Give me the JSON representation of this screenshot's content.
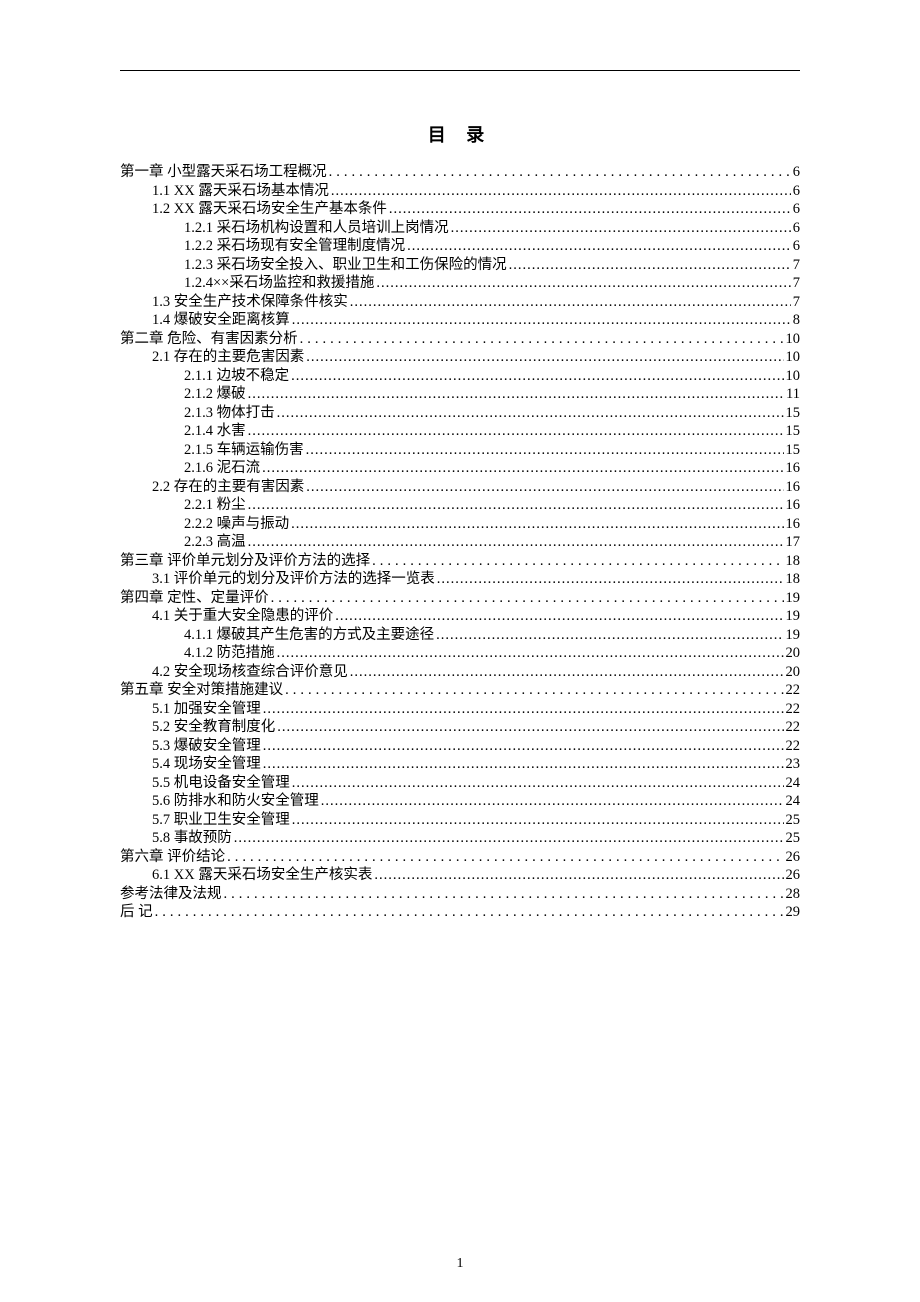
{
  "title": "目 录",
  "page_number": "1",
  "toc": [
    {
      "level": 0,
      "label": "第一章   小型露天采石场工程概况",
      "page": "6",
      "wide": true
    },
    {
      "level": 1,
      "label": "1.1 XX 露天采石场基本情况",
      "page": "6",
      "wide": false
    },
    {
      "level": 1,
      "label": "1.2 XX 露天采石场安全生产基本条件",
      "page": "6",
      "wide": false
    },
    {
      "level": 2,
      "label": "1.2.1 采石场机构设置和人员培训上岗情况",
      "page": "6",
      "wide": false
    },
    {
      "level": 2,
      "label": "1.2.2 采石场现有安全管理制度情况",
      "page": "6",
      "wide": false
    },
    {
      "level": 2,
      "label": "1.2.3 采石场安全投入、职业卫生和工伤保险的情况",
      "page": "7",
      "wide": false
    },
    {
      "level": 2,
      "label": "1.2.4××采石场监控和救援措施",
      "page": "7",
      "wide": false
    },
    {
      "level": 1,
      "label": "1.3 安全生产技术保障条件核实",
      "page": "7",
      "wide": false
    },
    {
      "level": 1,
      "label": "1.4 爆破安全距离核算",
      "page": "8",
      "wide": false
    },
    {
      "level": 0,
      "label": "第二章   危险、有害因素分析",
      "page": "10",
      "wide": true
    },
    {
      "level": 1,
      "label": "2.1 存在的主要危害因素",
      "page": "10",
      "wide": false
    },
    {
      "level": 2,
      "label": "2.1.1 边坡不稳定",
      "page": "10",
      "wide": false
    },
    {
      "level": 2,
      "label": "2.1.2 爆破",
      "page": "11",
      "wide": false
    },
    {
      "level": 2,
      "label": "2.1.3 物体打击",
      "page": "15",
      "wide": false
    },
    {
      "level": 2,
      "label": "2.1.4 水害",
      "page": "15",
      "wide": false
    },
    {
      "level": 2,
      "label": "2.1.5 车辆运输伤害",
      "page": "15",
      "wide": false
    },
    {
      "level": 2,
      "label": "2.1.6 泥石流",
      "page": "16",
      "wide": false
    },
    {
      "level": 1,
      "label": "2.2  存在的主要有害因素",
      "page": "16",
      "wide": false
    },
    {
      "level": 2,
      "label": "2.2.1 粉尘",
      "page": "16",
      "wide": false
    },
    {
      "level": 2,
      "label": "2.2.2 噪声与振动",
      "page": "16",
      "wide": false
    },
    {
      "level": 2,
      "label": "2.2.3 高温",
      "page": "17",
      "wide": false
    },
    {
      "level": 0,
      "label": "第三章   评价单元划分及评价方法的选择",
      "page": "18",
      "wide": true
    },
    {
      "level": 1,
      "label": "3.1 评价单元的划分及评价方法的选择一览表",
      "page": "18",
      "wide": false
    },
    {
      "level": 0,
      "label": "第四章   定性、定量评价",
      "page": "19",
      "wide": true
    },
    {
      "level": 1,
      "label": "4.1 关于重大安全隐患的评价",
      "page": "19",
      "wide": false
    },
    {
      "level": 2,
      "label": "4.1.1 爆破其产生危害的方式及主要途径",
      "page": "19",
      "wide": false
    },
    {
      "level": 2,
      "label": "4.1.2 防范措施",
      "page": "20",
      "wide": false
    },
    {
      "level": 1,
      "label": "4.2 安全现场核查综合评价意见",
      "page": "20",
      "wide": false
    },
    {
      "level": 0,
      "label": "第五章   安全对策措施建议",
      "page": "22",
      "wide": true
    },
    {
      "level": 1,
      "label": "5.1 加强安全管理",
      "page": "22",
      "wide": false
    },
    {
      "level": 1,
      "label": "5.2 安全教育制度化",
      "page": "22",
      "wide": false
    },
    {
      "level": 1,
      "label": "5.3 爆破安全管理",
      "page": "22",
      "wide": false
    },
    {
      "level": 1,
      "label": "5.4 现场安全管理",
      "page": "23",
      "wide": false
    },
    {
      "level": 1,
      "label": "5.5 机电设备安全管理",
      "page": "24",
      "wide": false
    },
    {
      "level": 1,
      "label": "5.6 防排水和防火安全管理",
      "page": "24",
      "wide": false
    },
    {
      "level": 1,
      "label": "5.7 职业卫生安全管理",
      "page": "25",
      "wide": false
    },
    {
      "level": 1,
      "label": "5.8 事故预防",
      "page": "25",
      "wide": false
    },
    {
      "level": 0,
      "label": "第六章   评价结论",
      "page": "26",
      "wide": true
    },
    {
      "level": 1,
      "label": "6.1 XX 露天采石场安全生产核实表",
      "page": "26",
      "wide": false
    },
    {
      "level": 0,
      "label": "参考法律及法规",
      "page": "28",
      "wide": true
    },
    {
      "level": 0,
      "label": "后 记",
      "page": "29",
      "wide": true
    }
  ]
}
